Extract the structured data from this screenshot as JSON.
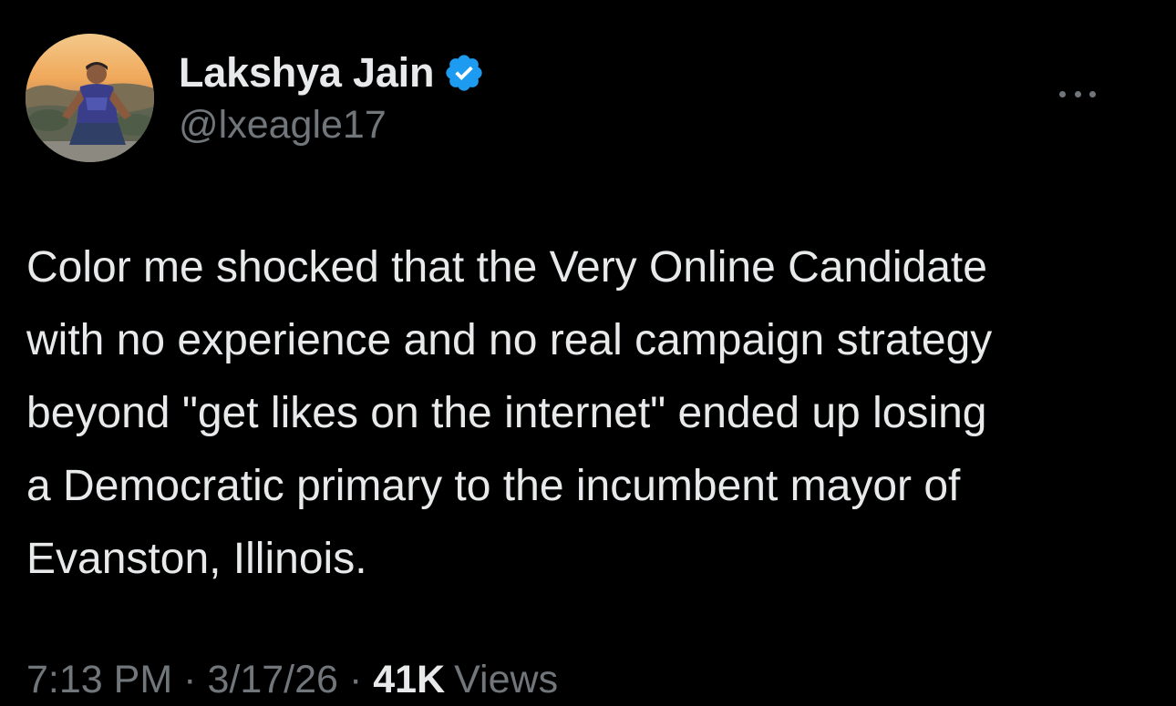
{
  "author": {
    "display_name": "Lakshya Jain",
    "handle": "@lxeagle17",
    "verified_color": "#1d9bf0"
  },
  "icons": {
    "avatar": "profile-photo",
    "verified": "verified-badge-icon",
    "more": "more-options-icon"
  },
  "tweet": {
    "text": "Color me shocked that the Very Online Candidate\nwith no experience and no real campaign strategy\nbeyond \"get likes on the internet\" ended up losing\na Democratic primary to the incumbent mayor of\nEvanston, Illinois."
  },
  "meta": {
    "time": "7:13 PM",
    "separator": "·",
    "date": "3/17/26",
    "views_count": "41K",
    "views_label": "Views"
  },
  "colors": {
    "background": "#000000",
    "primary_text": "#e7e9ea",
    "secondary_text": "#71767b"
  }
}
